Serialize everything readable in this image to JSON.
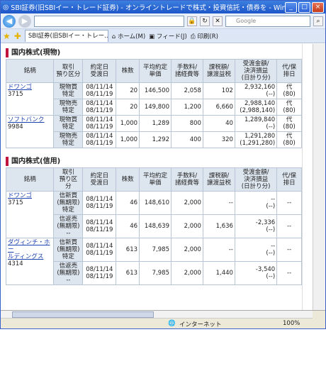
{
  "window": {
    "title": "SBI証券(旧SBIイー・トレード証券) - オンライントレードで株式・投資信託・債券を - Wind...",
    "buttons": [
      "_",
      "□",
      "×"
    ]
  },
  "toolbar": {
    "search_placeholder": "Google",
    "tab_label": "SBI証券(旧SBIイー・トレー...",
    "home_label": "ホーム(M)",
    "feed_label": "フィード(J)",
    "print_label": "印刷(R)"
  },
  "section1": {
    "title": "国内株式(現物)",
    "headers": [
      "銘柄",
      "取引\n預り区分",
      "約定日\n受渡日",
      "株数",
      "平均約定\n単価",
      "手数料/\n諸経費等",
      "課税額/\n譲渡益税",
      "受渡金額/\n決済損益\n(日計り分)",
      "代/保\n排日"
    ],
    "groups": [
      {
        "name": "ドワンゴ",
        "code": "3715",
        "rows": [
          {
            "type": "現物買\n特定",
            "dates": "08/11/14\n08/11/19",
            "qty": "20",
            "price": "146,500",
            "fee": "2,058",
            "tax": "102",
            "amount": "2,932,160\n(--)",
            "stat": "代\n(80)"
          },
          {
            "type": "現物売\n特定",
            "dates": "08/11/14\n08/11/19",
            "qty": "20",
            "price": "149,800",
            "fee": "1,200",
            "tax": "6,660",
            "amount": "2,988,140\n(2,988,140)",
            "stat": "代\n(80)"
          }
        ]
      },
      {
        "name": "ソフトバンク",
        "code": "9984",
        "rows": [
          {
            "type": "現物買\n特定",
            "dates": "08/11/14\n08/11/19",
            "qty": "1,000",
            "price": "1,289",
            "fee": "800",
            "tax": "40",
            "amount": "1,289,840\n(--)",
            "stat": "代\n(80)"
          },
          {
            "type": "現物売\n特定",
            "dates": "08/11/14\n08/11/19",
            "qty": "1,000",
            "price": "1,292",
            "fee": "400",
            "tax": "320",
            "amount": "1,291,280\n(1,291,280)",
            "stat": "代\n(80)"
          }
        ]
      }
    ]
  },
  "section2": {
    "title": "国内株式(信用)",
    "headers": [
      "銘柄",
      "取引\n預り区\n分",
      "約定日\n受渡日",
      "株数",
      "平均約定\n単価",
      "手数料/\n諸経費等",
      "課税額/\n譲渡益税",
      "受渡金額/\n決済損益\n(日計り分)",
      "代/保\n排日"
    ],
    "groups": [
      {
        "name": "ドワンゴ",
        "code": "3715",
        "rows": [
          {
            "type": "信新買\n(無期限)\n特定",
            "dates": "08/11/14\n08/11/19",
            "qty": "46",
            "price": "148,610",
            "fee": "2,000",
            "tax": "--",
            "amount": "--\n(--)",
            "stat": "--"
          },
          {
            "type": "信返売\n(無期限)\n--",
            "dates": "08/11/14\n08/11/19",
            "qty": "46",
            "price": "148,639",
            "fee": "2,000",
            "tax": "1,636",
            "amount": "-2,336\n(--)",
            "stat": "--"
          }
        ]
      },
      {
        "name": "ダヴィンチ・ホー\nルディングス",
        "code": "4314",
        "rows": [
          {
            "type": "信新買\n(無期限)\n特定",
            "dates": "08/11/14\n08/11/19",
            "qty": "613",
            "price": "7,985",
            "fee": "2,000",
            "tax": "--",
            "amount": "--\n(--)",
            "stat": "--"
          },
          {
            "type": "信返売\n(無期限)\n--",
            "dates": "08/11/14\n08/11/19",
            "qty": "613",
            "price": "7,985",
            "fee": "2,000",
            "tax": "1,440",
            "amount": "-3,540\n(--)",
            "stat": "--"
          }
        ]
      }
    ]
  },
  "status": {
    "zone": "インターネット",
    "zoom": "100%"
  }
}
